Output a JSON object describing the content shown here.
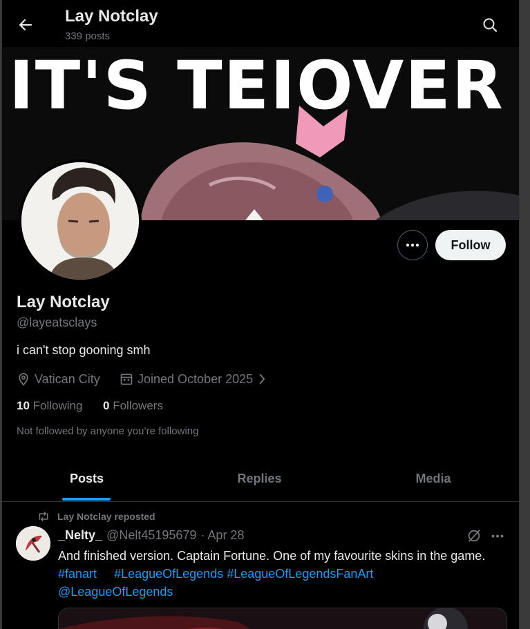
{
  "header": {
    "name": "Lay Notclay",
    "post_count": "339 posts"
  },
  "banner": {
    "text": "IT'S TEIOVER"
  },
  "actions": {
    "follow_label": "Follow"
  },
  "profile": {
    "name": "Lay Notclay",
    "handle": "@layeatsclays",
    "bio": "i can't stop gooning smh",
    "location": "Vatican City",
    "joined": "Joined October 2025",
    "following_count": "10",
    "following_label": "Following",
    "followers_count": "0",
    "followers_label": "Followers",
    "not_followed_note": "Not followed by anyone you’re following"
  },
  "tabs": [
    {
      "label": "Posts",
      "active": true
    },
    {
      "label": "Replies",
      "active": false
    },
    {
      "label": "Media",
      "active": false
    }
  ],
  "timeline": [
    {
      "repost_label": "Lay Notclay reposted",
      "author": "_Nelty_",
      "handle": "@Nelt45195679",
      "date": "· Apr 28",
      "text": "And finished version. Captain Fortune. One of my favourite skins in the game. ",
      "hashtags": [
        "#fanart",
        "#LeagueOfLegends",
        "#LeagueOfLegendsFanArt"
      ],
      "mention": "@LeagueOfLegends"
    }
  ],
  "colors": {
    "background": "#000000",
    "accent": "#1d9bf0",
    "muted_text": "#71767b",
    "primary_text": "#e7e9ea",
    "follow_button_bg": "#eff3f4"
  },
  "icons": [
    "back-arrow-icon",
    "search-icon",
    "more-icon",
    "location-icon",
    "calendar-icon",
    "chevron-right-icon",
    "repost-icon",
    "grok-icon"
  ]
}
